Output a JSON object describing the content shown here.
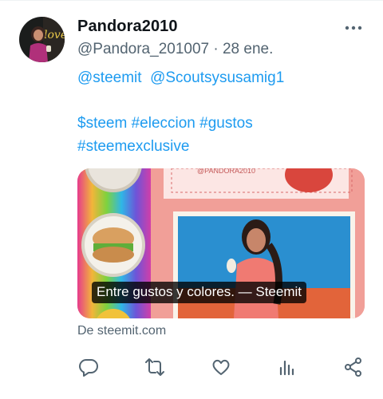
{
  "tweet": {
    "author_name": "Pandora2010",
    "handle": "@Pandora_201007",
    "separator": "·",
    "date": "28 ene.",
    "mentions": [
      "@steemit",
      "@Scoutsysusamig1"
    ],
    "hashtags_line1": "$steem #eleccion #gustos",
    "hashtags_line2": "#steemexclusive"
  },
  "card": {
    "caption": "Entre gustos y colores. — Steemit",
    "watermark": "@PANDORA2010",
    "source": "De steemit.com"
  },
  "icons": {
    "more": "more-icon",
    "reply": "reply-icon",
    "retweet": "retweet-icon",
    "like": "like-icon",
    "views": "views-icon",
    "share": "share-icon"
  },
  "colors": {
    "link": "#1d9bf0",
    "text": "#0f1419",
    "secondary": "#536471"
  }
}
